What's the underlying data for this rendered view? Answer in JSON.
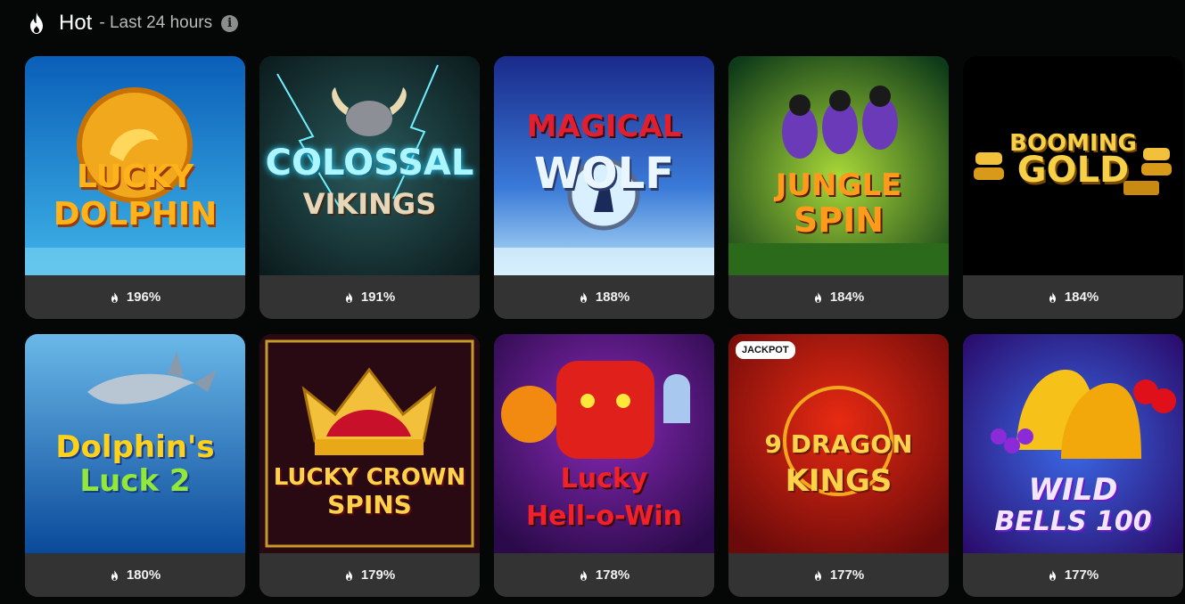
{
  "header": {
    "title": "Hot",
    "subtitle": "- Last 24 hours",
    "icon": "flame-icon",
    "info_icon": "info-icon"
  },
  "games": [
    {
      "line1": "LUCKY",
      "line2": "DOLPHIN",
      "stat": "196%",
      "badge": ""
    },
    {
      "line1": "COLOSSAL",
      "line2": "VIKINGS",
      "stat": "191%",
      "badge": ""
    },
    {
      "line1": "MAGICAL",
      "line2": "WOLF",
      "stat": "188%",
      "badge": ""
    },
    {
      "line1": "JUNGLE",
      "line2": "SPIN",
      "stat": "184%",
      "badge": ""
    },
    {
      "line1": "BOOMING",
      "line2": "GOLD",
      "stat": "184%",
      "badge": ""
    },
    {
      "line1": "Dolphin's",
      "line2": "Luck 2",
      "stat": "180%",
      "badge": ""
    },
    {
      "line1": "LUCKY CROWN",
      "line2": "SPINS",
      "stat": "179%",
      "badge": ""
    },
    {
      "line1": "Lucky",
      "line2": "Hell-o-Win",
      "stat": "178%",
      "badge": ""
    },
    {
      "line1": "9 DRAGON",
      "line2": "KINGS",
      "stat": "177%",
      "badge": "JACKPOT"
    },
    {
      "line1": "WILD",
      "line2": "BELLS 100",
      "stat": "177%",
      "badge": ""
    }
  ],
  "colors": {
    "background": "#040705",
    "card_footer": "#323332",
    "text": "#f2f2f2"
  }
}
